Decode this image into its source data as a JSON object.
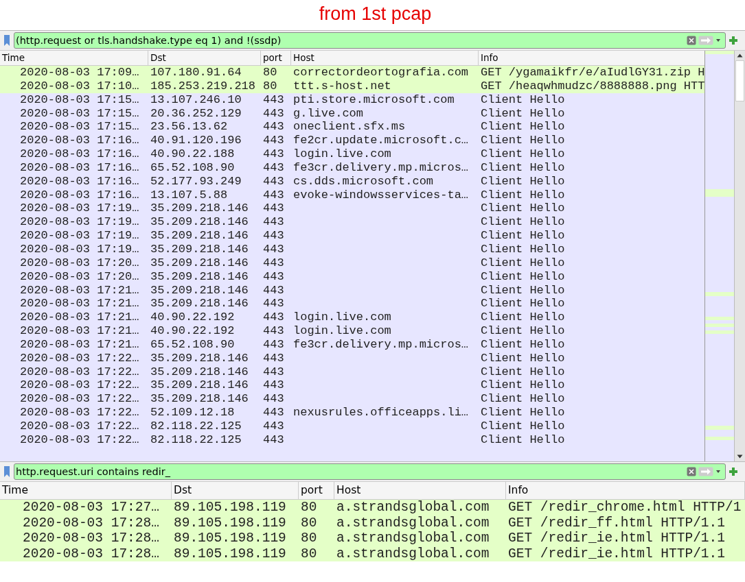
{
  "caption": "from 1st pcap",
  "panes": [
    {
      "filter": {
        "value": "(http.request or tls.handshake.type eq 1) and !(ssdp)"
      },
      "minimap": true,
      "columns": [
        "Time",
        "Dst",
        "port",
        "Host",
        "Info"
      ],
      "rows": [
        {
          "kind": "http",
          "cells": [
            "2020-08-03 17:09…",
            "107.180.91.64",
            "80",
            "correctordeortografia.com",
            "GET /ygamaikfr/e/aIudlGY31.zip H"
          ]
        },
        {
          "kind": "http",
          "cells": [
            "2020-08-03 17:10…",
            "185.253.219.218",
            "80",
            "ttt.s-host.net",
            "GET /heaqwhmudzc/8888888.png HTT"
          ]
        },
        {
          "kind": "tls",
          "cells": [
            "2020-08-03 17:15…",
            "13.107.246.10",
            "443",
            "pti.store.microsoft.com",
            "Client Hello"
          ]
        },
        {
          "kind": "tls",
          "cells": [
            "2020-08-03 17:15…",
            "20.36.252.129",
            "443",
            "g.live.com",
            "Client Hello"
          ]
        },
        {
          "kind": "tls",
          "cells": [
            "2020-08-03 17:15…",
            "23.56.13.62",
            "443",
            "oneclient.sfx.ms",
            "Client Hello"
          ]
        },
        {
          "kind": "tls",
          "cells": [
            "2020-08-03 17:16…",
            "40.91.120.196",
            "443",
            "fe2cr.update.microsoft.c…",
            "Client Hello"
          ]
        },
        {
          "kind": "tls",
          "cells": [
            "2020-08-03 17:16…",
            "40.90.22.188",
            "443",
            "login.live.com",
            "Client Hello"
          ]
        },
        {
          "kind": "tls",
          "cells": [
            "2020-08-03 17:16…",
            "65.52.108.90",
            "443",
            "fe3cr.delivery.mp.micros…",
            "Client Hello"
          ]
        },
        {
          "kind": "tls",
          "cells": [
            "2020-08-03 17:16…",
            "52.177.93.249",
            "443",
            "cs.dds.microsoft.com",
            "Client Hello"
          ]
        },
        {
          "kind": "tls",
          "cells": [
            "2020-08-03 17:16…",
            "13.107.5.88",
            "443",
            "evoke-windowsservices-ta…",
            "Client Hello"
          ]
        },
        {
          "kind": "tls",
          "cells": [
            "2020-08-03 17:19…",
            "35.209.218.146",
            "443",
            "",
            "Client Hello"
          ]
        },
        {
          "kind": "tls",
          "cells": [
            "2020-08-03 17:19…",
            "35.209.218.146",
            "443",
            "",
            "Client Hello"
          ]
        },
        {
          "kind": "tls",
          "cells": [
            "2020-08-03 17:19…",
            "35.209.218.146",
            "443",
            "",
            "Client Hello"
          ]
        },
        {
          "kind": "tls",
          "cells": [
            "2020-08-03 17:19…",
            "35.209.218.146",
            "443",
            "",
            "Client Hello"
          ]
        },
        {
          "kind": "tls",
          "cells": [
            "2020-08-03 17:20…",
            "35.209.218.146",
            "443",
            "",
            "Client Hello"
          ]
        },
        {
          "kind": "tls",
          "cells": [
            "2020-08-03 17:20…",
            "35.209.218.146",
            "443",
            "",
            "Client Hello"
          ]
        },
        {
          "kind": "tls",
          "cells": [
            "2020-08-03 17:21…",
            "35.209.218.146",
            "443",
            "",
            "Client Hello"
          ]
        },
        {
          "kind": "tls",
          "cells": [
            "2020-08-03 17:21…",
            "35.209.218.146",
            "443",
            "",
            "Client Hello"
          ]
        },
        {
          "kind": "tls",
          "cells": [
            "2020-08-03 17:21…",
            "40.90.22.192",
            "443",
            "login.live.com",
            "Client Hello"
          ]
        },
        {
          "kind": "tls",
          "cells": [
            "2020-08-03 17:21…",
            "40.90.22.192",
            "443",
            "login.live.com",
            "Client Hello"
          ]
        },
        {
          "kind": "tls",
          "cells": [
            "2020-08-03 17:21…",
            "65.52.108.90",
            "443",
            "fe3cr.delivery.mp.micros…",
            "Client Hello"
          ]
        },
        {
          "kind": "tls",
          "cells": [
            "2020-08-03 17:22…",
            "35.209.218.146",
            "443",
            "",
            "Client Hello"
          ]
        },
        {
          "kind": "tls",
          "cells": [
            "2020-08-03 17:22…",
            "35.209.218.146",
            "443",
            "",
            "Client Hello"
          ]
        },
        {
          "kind": "tls",
          "cells": [
            "2020-08-03 17:22…",
            "35.209.218.146",
            "443",
            "",
            "Client Hello"
          ]
        },
        {
          "kind": "tls",
          "cells": [
            "2020-08-03 17:22…",
            "35.209.218.146",
            "443",
            "",
            "Client Hello"
          ]
        },
        {
          "kind": "tls",
          "cells": [
            "2020-08-03 17:22…",
            "52.109.12.18",
            "443",
            "nexusrules.officeapps.li…",
            "Client Hello"
          ]
        },
        {
          "kind": "tls",
          "cells": [
            "2020-08-03 17:22…",
            "82.118.22.125",
            "443",
            "",
            "Client Hello"
          ]
        },
        {
          "kind": "tls",
          "cells": [
            "2020-08-03 17:22…",
            "82.118.22.125",
            "443",
            "",
            "Client Hello"
          ]
        }
      ]
    },
    {
      "filter": {
        "value": "http.request.uri contains redir_"
      },
      "columns": [
        "Time",
        "Dst",
        "port",
        "Host",
        "Info"
      ],
      "rows": [
        {
          "kind": "http",
          "cells": [
            "2020-08-03 17:27…",
            "89.105.198.119",
            "80",
            "a.strandsglobal.com",
            "GET /redir_chrome.html HTTP/1"
          ]
        },
        {
          "kind": "http",
          "cells": [
            "2020-08-03 17:28…",
            "89.105.198.119",
            "80",
            "a.strandsglobal.com",
            "GET /redir_ff.html HTTP/1.1"
          ]
        },
        {
          "kind": "http",
          "cells": [
            "2020-08-03 17:28…",
            "89.105.198.119",
            "80",
            "a.strandsglobal.com",
            "GET /redir_ie.html HTTP/1.1"
          ]
        },
        {
          "kind": "http",
          "cells": [
            "2020-08-03 17:28…",
            "89.105.198.119",
            "80",
            "a.strandsglobal.com",
            "GET /redir_ie.html HTTP/1.1"
          ]
        }
      ]
    }
  ]
}
